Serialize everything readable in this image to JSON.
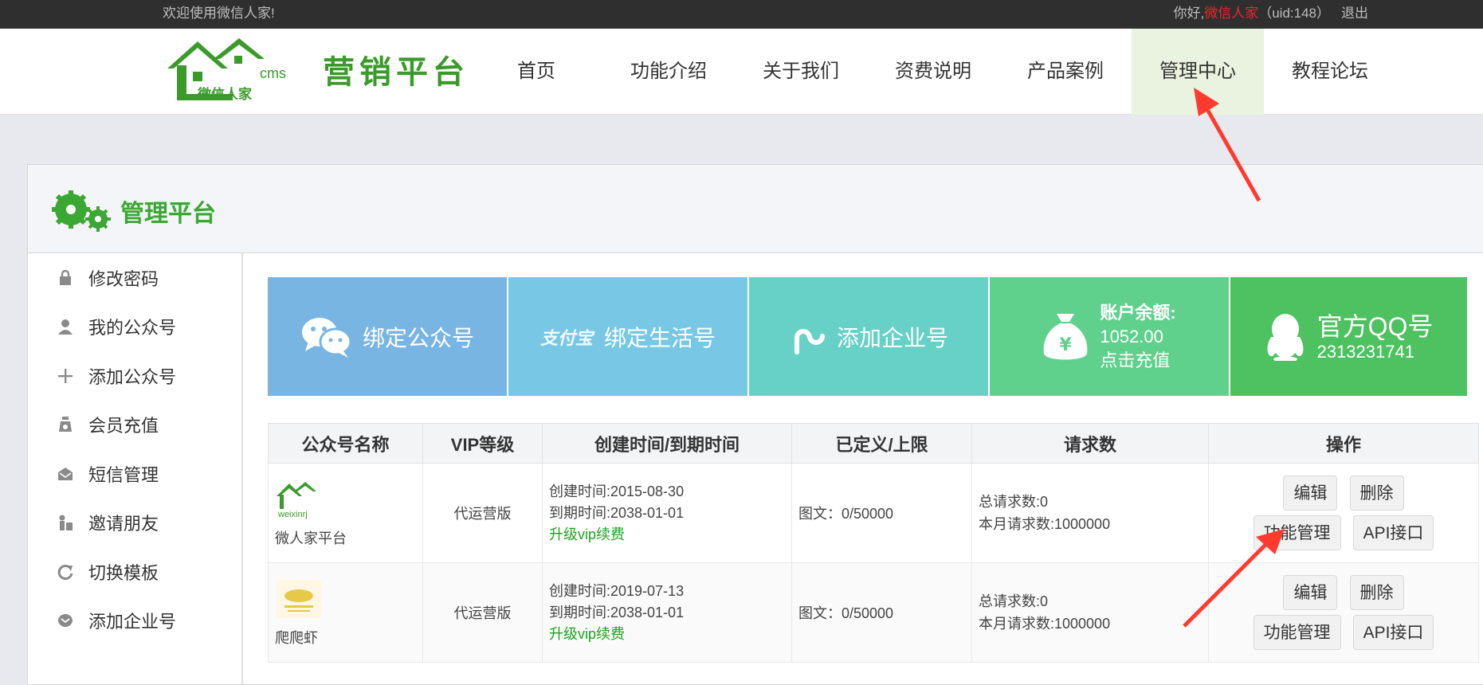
{
  "topbar": {
    "welcome": "欢迎使用微信人家!",
    "greeting": "你好,",
    "username": "微信人家",
    "uid": "（uid:148）",
    "logout": "退出"
  },
  "header": {
    "logo_text": "微信人家",
    "logo_cms": "cms",
    "brand": "营销平台",
    "nav": [
      "首页",
      "功能介绍",
      "关于我们",
      "资费说明",
      "产品案例",
      "管理中心",
      "教程论坛"
    ],
    "active_nav": "管理中心"
  },
  "panel": {
    "title": "管理平台",
    "sidebar": [
      {
        "label": "修改密码",
        "icon": "lock-icon"
      },
      {
        "label": "我的公众号",
        "icon": "user-icon"
      },
      {
        "label": "添加公众号",
        "icon": "plus-icon"
      },
      {
        "label": "会员充值",
        "icon": "money-bag-icon"
      },
      {
        "label": "短信管理",
        "icon": "envelope-icon"
      },
      {
        "label": "邀请朋友",
        "icon": "invite-icon"
      },
      {
        "label": "切换模板",
        "icon": "refresh-icon"
      },
      {
        "label": "添加企业号",
        "icon": "company-icon"
      }
    ]
  },
  "cards": {
    "bind_wechat": "绑定公众号",
    "alipay_logo": "支付宝",
    "bind_life": "绑定生活号",
    "add_company": "添加企业号",
    "balance_title": "账户余额:",
    "balance_value": "1052.00",
    "recharge": "点击充值",
    "qq_title": "官方QQ号",
    "qq_number": "2313231741",
    "colors": [
      "#79b5e2",
      "#78c8e5",
      "#68d1c7",
      "#5fd18d",
      "#4ec160"
    ]
  },
  "table": {
    "headers": [
      "公众号名称",
      "VIP等级",
      "创建时间/到期时间",
      "已定义/上限",
      "请求数",
      "操作"
    ],
    "rows": [
      {
        "thumb_text": "weixinrj",
        "name": "微人家平台",
        "vip": "代运营版",
        "created": "创建时间:2015-08-30",
        "expires": "到期时间:2038-01-01",
        "upgrade": "升级vip续费",
        "quota": "图文：0/50000",
        "total_req": "总请求数:0",
        "month_req": "本月请求数:1000000"
      },
      {
        "thumb_text": "",
        "name": "爬爬虾",
        "vip": "代运营版",
        "created": "创建时间:2019-07-13",
        "expires": "到期时间:2038-01-01",
        "upgrade": "升级vip续费",
        "quota": "图文：0/50000",
        "total_req": "总请求数:0",
        "month_req": "本月请求数:1000000"
      }
    ],
    "buttons": {
      "edit": "编辑",
      "delete": "删除",
      "features": "功能管理",
      "api": "API接口"
    }
  }
}
